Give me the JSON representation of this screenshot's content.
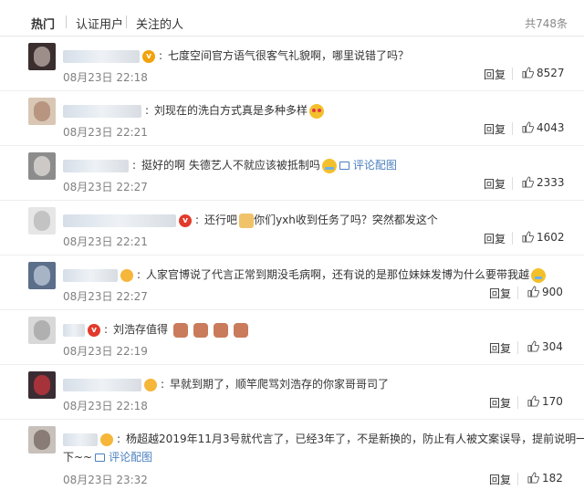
{
  "tabs": [
    {
      "label": "热门"
    },
    {
      "label": "认证用户"
    },
    {
      "label": "关注的人"
    }
  ],
  "total": "共748条",
  "comments": [
    {
      "text": "七度空间官方语气很客气礼貌啊，哪里说错了吗？",
      "time": "08月23日 22:18",
      "reply": "回复",
      "likes": "8527",
      "badge": "gold"
    },
    {
      "text": "刘现在的洗白方式真是多种多样",
      "time": "08月23日 22:21",
      "reply": "回复",
      "likes": "4043",
      "badge": "none"
    },
    {
      "text": "挺好的啊 失德艺人不就应该被抵制吗",
      "link": "评论配图",
      "time": "08月23日 22:27",
      "reply": "回复",
      "likes": "2333",
      "badge": "none"
    },
    {
      "text_a": "还行吧",
      "text_b": "你们yxh收到任务了吗？突然都发这个",
      "time": "08月23日 22:21",
      "reply": "回复",
      "likes": "1602",
      "badge": "red"
    },
    {
      "text": "人家官博说了代言正常到期没毛病啊，还有说的是那位妹妹发博为什么要带我越",
      "time": "08月23日 22:27",
      "reply": "回复",
      "likes": "900",
      "badge": "orange"
    },
    {
      "text": "刘浩存值得",
      "time": "08月23日 22:19",
      "reply": "回复",
      "likes": "304",
      "badge": "red"
    },
    {
      "text": "早就到期了，顺竿爬骂刘浩存的你家哥哥司了",
      "time": "08月23日 22:18",
      "reply": "回复",
      "likes": "170",
      "badge": "orange"
    },
    {
      "text_line1": "杨超越2019年11月3号就代言了，已经3年了，不是新换的，防止有人被文案误导，提前说明一",
      "text_line2": "下~~",
      "link": "评论配图",
      "time": "08月23日 23:32",
      "reply": "回复",
      "likes": "182",
      "badge": "orange"
    }
  ],
  "colors": {
    "link": "#4a7fbf",
    "time": "#808080",
    "gold_badge": "#f1a20d",
    "red_badge": "#e23a2b"
  },
  "icons": [
    "vip-badge-icon",
    "thumbs-up-icon",
    "emoji-icon",
    "picture-icon"
  ]
}
